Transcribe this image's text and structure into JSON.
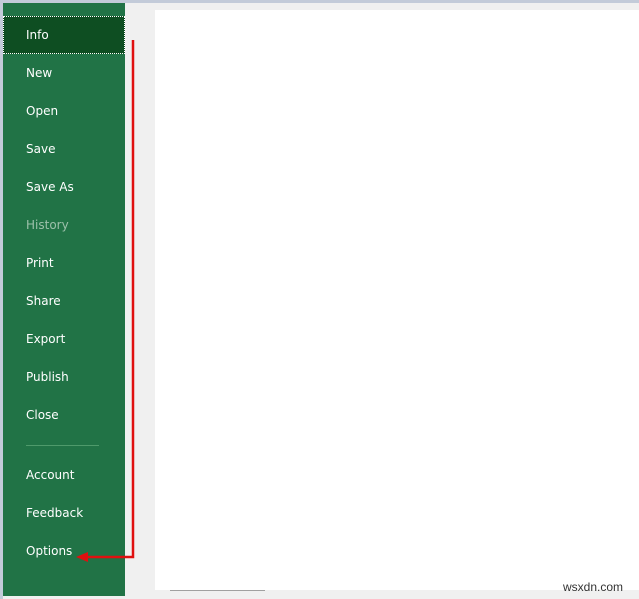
{
  "sidebar": {
    "items": [
      {
        "label": "Info",
        "state": "selected"
      },
      {
        "label": "New"
      },
      {
        "label": "Open"
      },
      {
        "label": "Save"
      },
      {
        "label": "Save As"
      },
      {
        "label": "History",
        "state": "disabled"
      },
      {
        "label": "Print"
      },
      {
        "label": "Share"
      },
      {
        "label": "Export"
      },
      {
        "label": "Publish"
      },
      {
        "label": "Close"
      }
    ],
    "bottom_items": [
      {
        "label": "Account"
      },
      {
        "label": "Feedback"
      },
      {
        "label": "Options"
      }
    ]
  },
  "annotation": {
    "color": "#e01010",
    "points_to": "Options"
  },
  "colors": {
    "sidebar": "#217346",
    "selected": "#0e4e22"
  },
  "watermark": "wsxdn.com"
}
